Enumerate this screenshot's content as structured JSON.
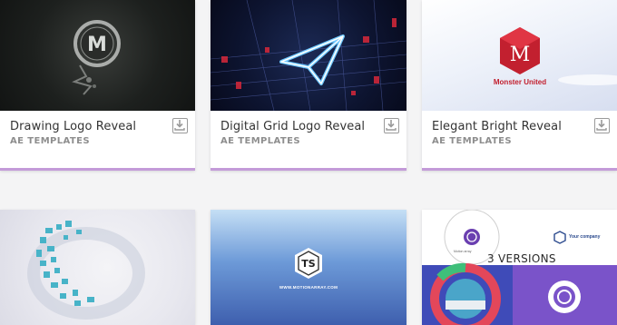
{
  "cards": [
    {
      "title": "Drawing Logo Reveal",
      "category": "AE TEMPLATES"
    },
    {
      "title": "Digital Grid Logo Reveal",
      "category": "AE TEMPLATES"
    },
    {
      "title": "Elegant Bright Reveal",
      "category": "AE TEMPLATES"
    },
    {
      "thumb_initials": "TS",
      "thumb_url": "WWW.MOTIONARRAY.COM"
    },
    {
      "versions_label": "3 VERSIONS",
      "company_label": "Your company",
      "small_caption": "Motion array"
    }
  ],
  "thumb3_brand": "Monster United",
  "thumb3_letter": "M",
  "thumb1_letter": "M",
  "accent_color": "#c39bd8"
}
